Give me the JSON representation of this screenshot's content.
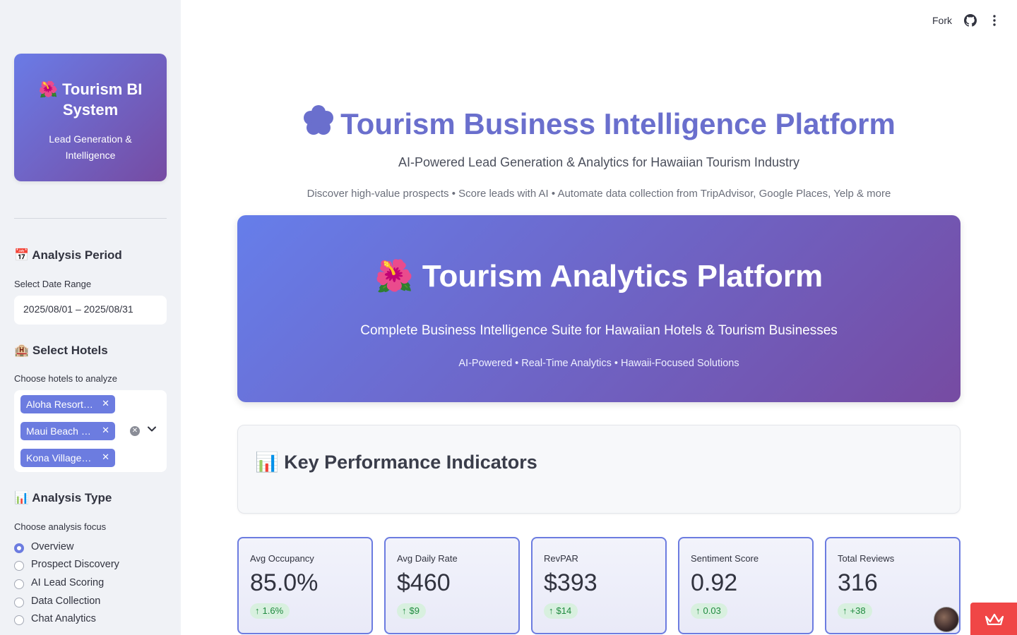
{
  "sidebar": {
    "brand_title": "🌺 Tourism BI System",
    "brand_subtitle": "Lead Generation & Intelligence",
    "analysis_period_heading": "📅 Analysis Period",
    "date_range_label": "Select Date Range",
    "date_range_value": "2025/08/01 – 2025/08/31",
    "hotels_heading": "🏨 Select Hotels",
    "hotels_label": "Choose hotels to analyze",
    "selected_hotels": [
      "Aloha Resort…",
      "Maui Beach …",
      "Kona Village…"
    ],
    "analysis_type_heading": "📊 Analysis Type",
    "analysis_type_label": "Choose analysis focus",
    "analysis_options": [
      "Overview",
      "Prospect Discovery",
      "AI Lead Scoring",
      "Data Collection",
      "Chat Analytics"
    ],
    "selected_option": "Overview"
  },
  "topbar": {
    "fork_label": "Fork",
    "github_icon": "github-icon",
    "menu_icon": "more-vertical-icon"
  },
  "header": {
    "title": "Tourism Business Intelligence Platform",
    "subtitle": "AI-Powered Lead Generation & Analytics for Hawaiian Tourism Industry",
    "tagline": "Discover high-value prospects • Score leads with AI • Automate data collection from TripAdvisor, Google Places, Yelp & more"
  },
  "hero": {
    "title": "🌺 Tourism Analytics Platform",
    "subtitle": "Complete Business Intelligence Suite for Hawaiian Hotels & Tourism Businesses",
    "tagline": "AI-Powered • Real-Time Analytics • Hawaii-Focused Solutions"
  },
  "kpi_section": {
    "heading": "📊 Key Performance Indicators",
    "cards": [
      {
        "label": "Avg Occupancy",
        "value": "85.0%",
        "delta": "1.6%"
      },
      {
        "label": "Avg Daily Rate",
        "value": "$460",
        "delta": "$9"
      },
      {
        "label": "RevPAR",
        "value": "$393",
        "delta": "$14"
      },
      {
        "label": "Sentiment Score",
        "value": "0.92",
        "delta": "0.03"
      },
      {
        "label": "Total Reviews",
        "value": "316",
        "delta": "+38"
      }
    ]
  },
  "colors": {
    "accent": "#6c7ce0",
    "gradient_start": "#667eea",
    "gradient_end": "#764ba2",
    "delta_positive": "#1f8a3f",
    "streamlit_badge": "#f04646"
  }
}
